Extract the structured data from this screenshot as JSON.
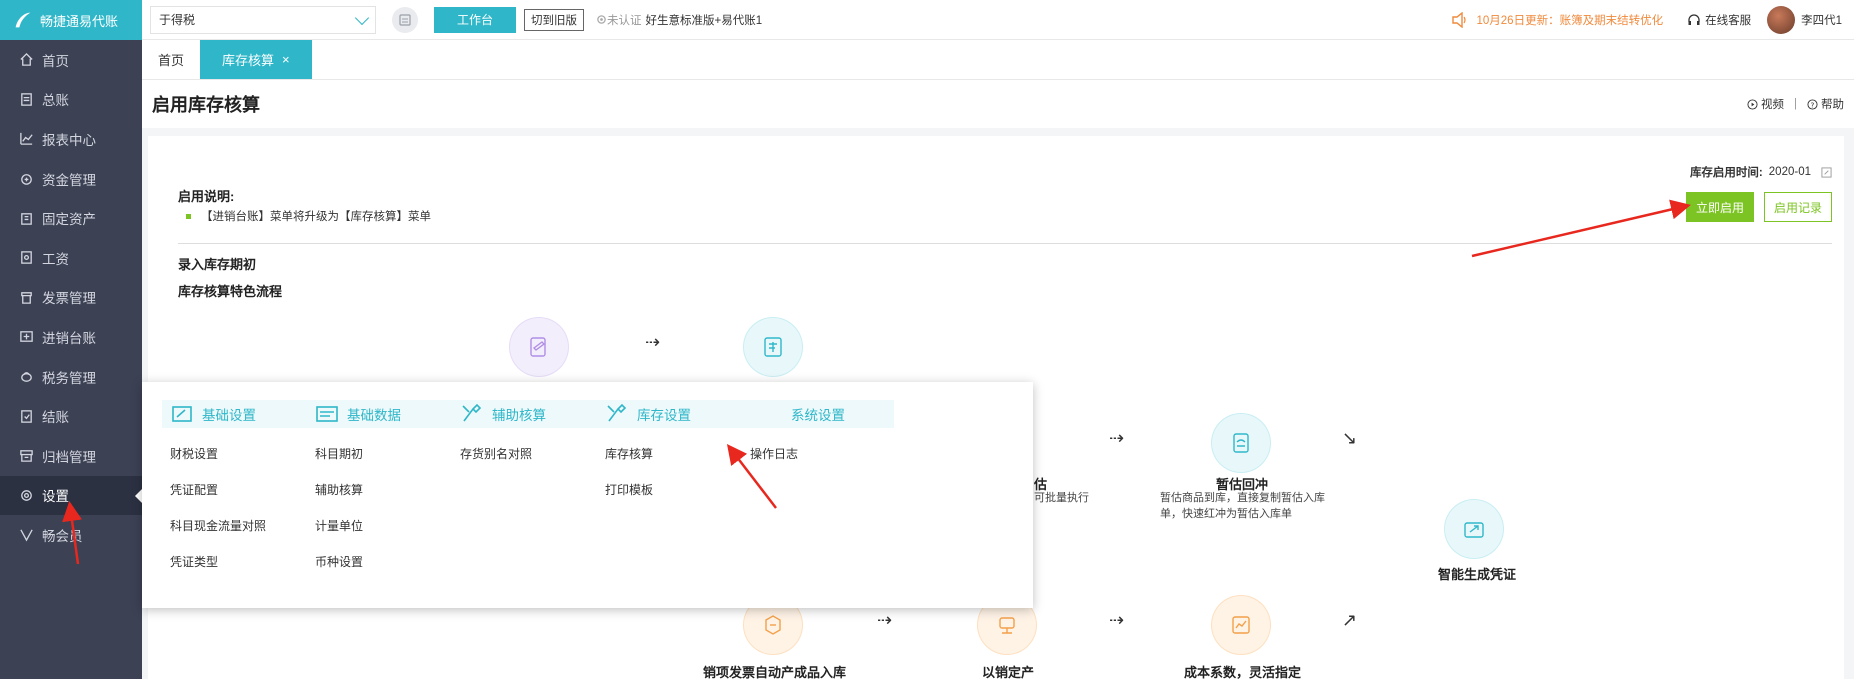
{
  "app": {
    "logo_text": "畅捷通易代账"
  },
  "sidebar": {
    "items": [
      {
        "label": "首页",
        "icon": "home-icon"
      },
      {
        "label": "总账",
        "icon": "ledger-icon"
      },
      {
        "label": "报表中心",
        "icon": "chart-icon"
      },
      {
        "label": "资金管理",
        "icon": "wallet-icon"
      },
      {
        "label": "固定资产",
        "icon": "asset-icon"
      },
      {
        "label": "工资",
        "icon": "salary-icon"
      },
      {
        "label": "发票管理",
        "icon": "invoice-icon"
      },
      {
        "label": "进销台账",
        "icon": "stock-ledger-icon"
      },
      {
        "label": "税务管理",
        "icon": "tax-icon"
      },
      {
        "label": "结账",
        "icon": "close-account-icon"
      },
      {
        "label": "归档管理",
        "icon": "archive-icon"
      },
      {
        "label": "设置",
        "icon": "gear-icon",
        "active": true
      },
      {
        "label": "畅会员",
        "icon": "vip-icon"
      }
    ]
  },
  "topbar": {
    "company": "于得税",
    "workbench_label": "工作台",
    "old_version_label": "切到旧版",
    "uncertified": "未认证",
    "template": "好生意标准版+易代账1",
    "notice": "10月26日更新：账簿及期末结转优化",
    "service": "在线客服",
    "user": "李四代1"
  },
  "tabs": [
    {
      "label": "首页",
      "active": false
    },
    {
      "label": "库存核算",
      "active": true,
      "close": "×"
    }
  ],
  "page": {
    "title": "启用库存核算",
    "video_label": "视频",
    "help_label": "帮助",
    "sep": "|",
    "inventory_time_label": "库存启用时间:",
    "inventory_time_value": "2020-01",
    "enable_now": "立即启用",
    "enable_record": "启用记录",
    "desc_title": "启用说明:",
    "desc_item": "【进销台账】菜单将升级为【库存核算】菜单",
    "section_opening": "录入库存期初",
    "section_flow": "库存核算特色流程"
  },
  "flow": {
    "est_label": "估",
    "est_desc": "可批量执行",
    "reverse_label": "暂估回冲",
    "reverse_desc": "暂估商品到库，直接复制暂估入库单，快速红冲为暂估入库单",
    "voucher_label": "智能生成凭证",
    "sales_label": "销项发票自动产成品入库",
    "cost_label": "以销定产",
    "coef_label": "成本系数，灵活指定"
  },
  "dropdown": {
    "columns": [
      {
        "title": "基础设置",
        "items": [
          "财税设置",
          "凭证配置",
          "科目现金流量对照",
          "凭证类型"
        ]
      },
      {
        "title": "基础数据",
        "items": [
          "科目期初",
          "辅助核算",
          "计量单位",
          "币种设置"
        ]
      },
      {
        "title": "辅助核算",
        "items": [
          "存货别名对照"
        ]
      },
      {
        "title": "库存设置",
        "items": [
          "库存核算",
          "打印模板"
        ]
      },
      {
        "title": "系统设置",
        "items": [
          "操作日志"
        ]
      }
    ]
  },
  "colors": {
    "accent": "#2fb7c9",
    "green": "#7cc423",
    "sidebar": "#3c4154",
    "notice": "#f08a3c",
    "annotation": "#e8281e"
  }
}
